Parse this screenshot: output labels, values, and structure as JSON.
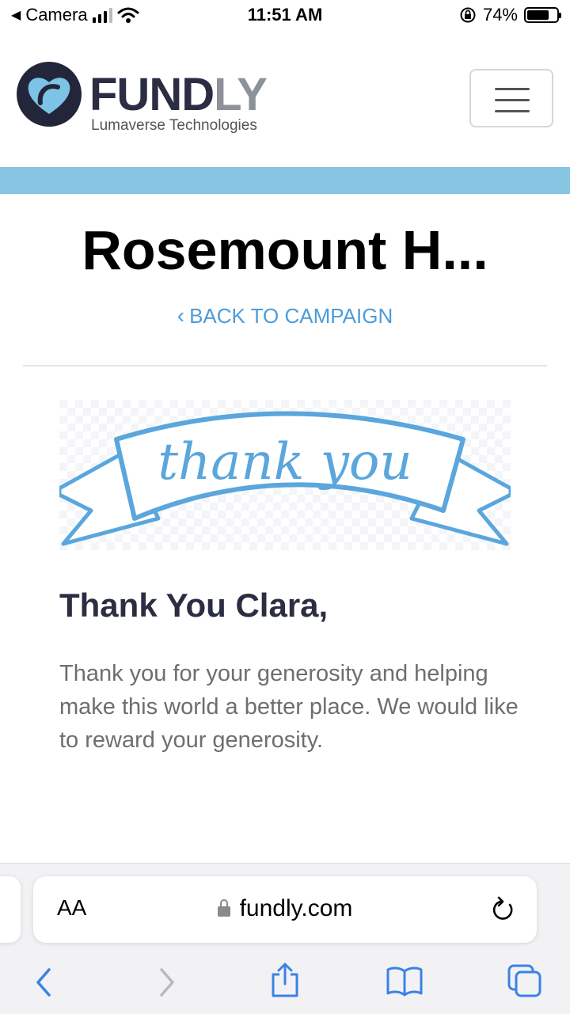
{
  "status_bar": {
    "back_app": "Camera",
    "time": "11:51 AM",
    "battery": "74%",
    "battery_level": 0.74
  },
  "header": {
    "brand_part1": "FUND",
    "brand_part2": "LY",
    "tagline": "Lumaverse Technologies",
    "menu_icon": "hamburger-icon",
    "colors": {
      "dark": "#2b2d42",
      "light": "#8d9199",
      "accent_band": "#88c5e2"
    }
  },
  "campaign": {
    "title": "Rosemount H...",
    "back_link": "BACK TO CAMPAIGN"
  },
  "thanks": {
    "banner_text": "thank you",
    "heading": "Thank You Clara,",
    "message": "Thank you for your generosity and helping make this world a better place. We would like to reward your generosity."
  },
  "browser": {
    "text_size_label": "AA",
    "url": "fundly.com",
    "icons": [
      "back-icon",
      "forward-icon",
      "share-icon",
      "bookmarks-icon",
      "tabs-icon",
      "reload-icon",
      "lock-icon"
    ]
  }
}
